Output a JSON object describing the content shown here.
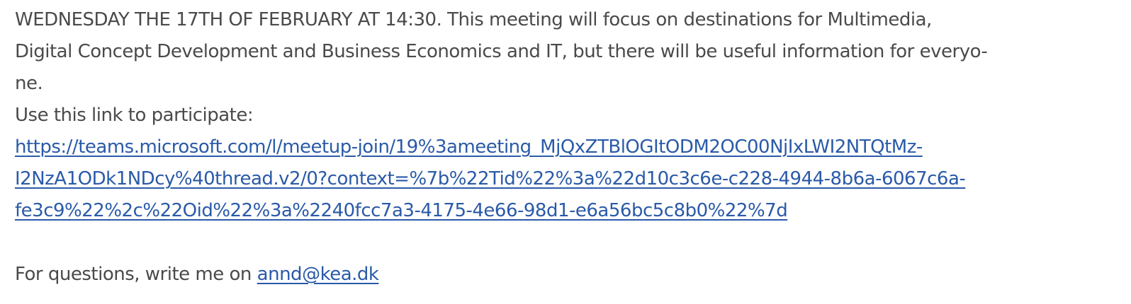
{
  "announcement": {
    "line1": "WEDNESDAY THE 17TH OF FEBRUARY AT 14:30. This meeting will focus on destinations for Multimedia,",
    "line2": "Digital Concept Development and Business Economics and IT, but there will be useful information for everyo-",
    "line3": "ne."
  },
  "participate": {
    "label": "Use this link to participate:",
    "link_line1": "https://teams.microsoft.com/l/meetup-join/19%3ameeting_MjQxZTBlOGItODM2OC00NjIxLWI2NTQtMz-",
    "link_line2": "I2NzA1ODk1NDcy%40thread.v2/0?context=%7b%22Tid%22%3a%22d10c3c6e-c228-4944-8b6a-6067c6a-",
    "link_line3": "fe3c9%22%2c%22Oid%22%3a%2240fcc7a3-4175-4e66-98d1-e6a56bc5c8b0%22%7d"
  },
  "contact": {
    "text": "For questions, write me on ",
    "email": "annd@kea.dk"
  },
  "colors": {
    "text": "#4a4a4a",
    "link": "#2a5aa8",
    "background": "#ffffff"
  }
}
